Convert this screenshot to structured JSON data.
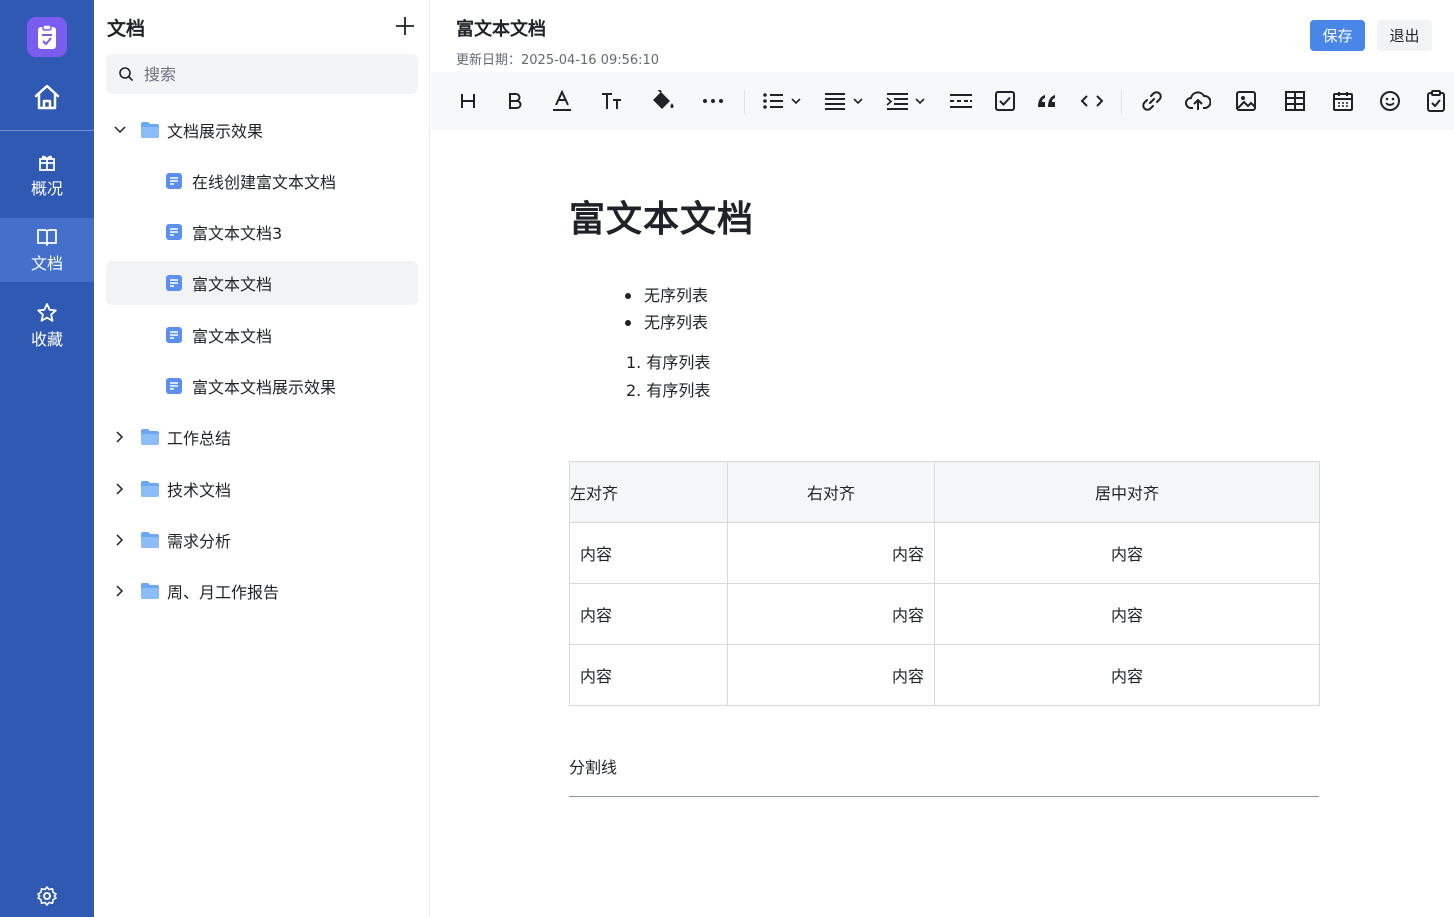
{
  "rail": {
    "items": [
      {
        "label": "概况"
      },
      {
        "label": "文档"
      },
      {
        "label": "收藏"
      }
    ]
  },
  "tree": {
    "title": "文档",
    "search_placeholder": "搜索",
    "nodes": [
      {
        "label": "文档展示效果",
        "type": "folder",
        "expanded": true
      },
      {
        "label": "在线创建富文本文档",
        "type": "doc"
      },
      {
        "label": "富文本文档3",
        "type": "doc"
      },
      {
        "label": "富文本文档",
        "type": "doc",
        "selected": true
      },
      {
        "label": "富文本文档",
        "type": "doc"
      },
      {
        "label": "富文本文档展示效果",
        "type": "doc"
      },
      {
        "label": "工作总结",
        "type": "folder",
        "expanded": false
      },
      {
        "label": "技术文档",
        "type": "folder",
        "expanded": false
      },
      {
        "label": "需求分析",
        "type": "folder",
        "expanded": false
      },
      {
        "label": "周、月工作报告",
        "type": "folder",
        "expanded": false
      }
    ]
  },
  "header": {
    "title": "富文本文档",
    "updated": "更新日期：2025-04-16 09:56:10",
    "save_label": "保存",
    "exit_label": "退出"
  },
  "toolbar": {
    "icons": [
      "heading-icon",
      "bold-icon",
      "font-color-icon",
      "font-size-icon",
      "paint-bucket-icon",
      "more-icon",
      "bullet-list-icon",
      "align-icon",
      "indent-icon",
      "divider-icon",
      "task-list-icon",
      "quote-icon",
      "code-icon",
      "link-icon",
      "upload-icon",
      "image-icon",
      "table-icon",
      "calendar-icon",
      "emoji-icon",
      "clipboard-icon"
    ]
  },
  "document": {
    "heading": "富文本文档",
    "bullets": [
      "无序列表",
      "无序列表"
    ],
    "ordered": [
      "1. 有序列表",
      "2. 有序列表"
    ],
    "table": {
      "headers": [
        "左对齐",
        "右对齐",
        "居中对齐"
      ],
      "rows": [
        [
          "内容",
          "内容",
          "内容"
        ],
        [
          "内容",
          "内容",
          "内容"
        ],
        [
          "内容",
          "内容",
          "内容"
        ]
      ]
    },
    "divider_label": "分割线"
  },
  "colors": {
    "rail": "#2f59b3",
    "rail_active": "#4470cc",
    "logo": "#7b5cf0",
    "primary": "#4a86e8",
    "folder": "#6aa8f5"
  }
}
